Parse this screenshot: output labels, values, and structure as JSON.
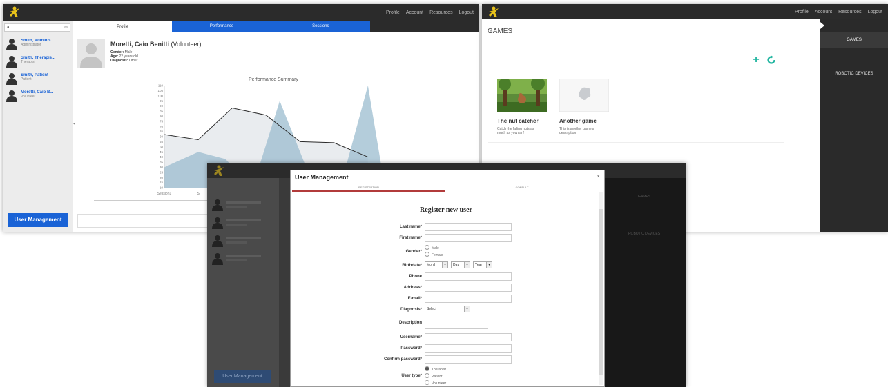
{
  "left_window": {
    "nav": [
      "Profile",
      "Account",
      "Resources",
      "Logout"
    ],
    "search_clear": "⊗",
    "search_placeholder": "a",
    "users": [
      {
        "name": "Smith, Adminis...",
        "role": "Administrator"
      },
      {
        "name": "Smith, Therapis...",
        "role": "Therapist"
      },
      {
        "name": "Smith, Patient",
        "role": "Patient"
      },
      {
        "name": "Moretti, Caio B...",
        "role": "Volunteer"
      }
    ],
    "user_management_label": "User Management",
    "tabs": [
      "Profile",
      "Performance",
      "Sessions"
    ],
    "collapse_arrow": "◂",
    "profile": {
      "name": "Moretti, Caio Benitti",
      "role": "(Volunteer)",
      "gender_label": "Gender:",
      "gender_value": "Male",
      "age_label": "Age:",
      "age_value": "22 years old",
      "diagnosis_label": "Diagnosis:",
      "diagnosis_value": "Other"
    }
  },
  "chart_data": {
    "type": "line",
    "title": "Performance Summary",
    "ylim": [
      10,
      110
    ],
    "yticks": [
      110,
      105,
      100,
      95,
      90,
      85,
      80,
      75,
      70,
      65,
      60,
      55,
      50,
      45,
      40,
      35,
      30,
      25,
      20,
      15,
      10
    ],
    "xticks": [
      "Session1",
      "S"
    ],
    "line_series": {
      "x": [
        0,
        1,
        2,
        3,
        4,
        5,
        6
      ],
      "values": [
        62,
        57,
        88,
        81,
        55,
        54,
        40
      ]
    },
    "area_series": {
      "x": [
        0,
        1,
        1.8,
        2.6,
        3.4,
        4.3,
        5.2,
        6,
        6.5,
        7
      ],
      "values": [
        30,
        45,
        38,
        10,
        95,
        20,
        12,
        110,
        10,
        10
      ]
    },
    "grid": false,
    "colors": {
      "line": "#2b2b2b",
      "area": "#9bbccf",
      "band": "#e9ecef"
    }
  },
  "right_window": {
    "nav": [
      "Profile",
      "Account",
      "Resources",
      "Logout"
    ],
    "title": "GAMES",
    "search_placeholder": "",
    "games": [
      {
        "name": "The nut catcher",
        "description": "Catch the falling nuts as much as you can!"
      },
      {
        "name": "Another game",
        "description": "This is another game's description"
      }
    ],
    "side_items": [
      "GAMES",
      "ROBOTIC DEVICES"
    ]
  },
  "front_window": {
    "user_management_label": "User Management",
    "side_items": [
      "GAMES",
      "ROBOTIC DEVICES"
    ],
    "modal": {
      "title": "User Management",
      "close": "×",
      "tabs": [
        "REGISTRATION",
        "CONSULT"
      ],
      "form_title": "Register new user",
      "fields": {
        "last_name": "Last name*",
        "first_name": "First name*",
        "gender": "Gender*",
        "birthdate": "Birthdate*",
        "phone": "Phone",
        "address": "Address*",
        "email": "E-mail*",
        "diagnosis": "Diagnosis*",
        "description": "Description",
        "username": "Username*",
        "password": "Password*",
        "confirm_password": "Confirm password*",
        "user_type": "User type*"
      },
      "gender_options": [
        "Male",
        "Female"
      ],
      "birth_month": "Month",
      "birth_day": "Day",
      "birth_year": "Year",
      "diagnosis_selected": "Select",
      "user_type_options": [
        "Therapist",
        "Patient",
        "Volunteer"
      ]
    }
  },
  "colors": {
    "accent": "#1a63d6",
    "dark": "#2b2b2b",
    "teal": "#21b5a0",
    "logo": "#e8c21a"
  }
}
